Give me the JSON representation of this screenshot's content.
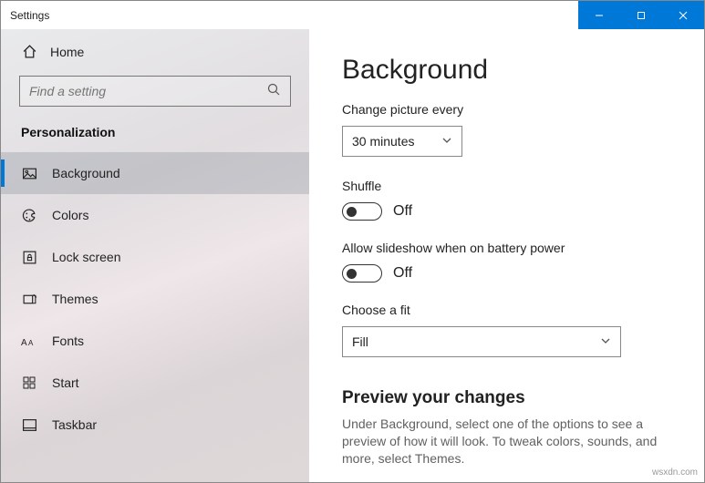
{
  "window": {
    "title": "Settings"
  },
  "sidebar": {
    "home": "Home",
    "search_placeholder": "Find a setting",
    "section": "Personalization",
    "items": [
      {
        "label": "Background"
      },
      {
        "label": "Colors"
      },
      {
        "label": "Lock screen"
      },
      {
        "label": "Themes"
      },
      {
        "label": "Fonts"
      },
      {
        "label": "Start"
      },
      {
        "label": "Taskbar"
      }
    ]
  },
  "content": {
    "title": "Background",
    "change_label": "Change picture every",
    "change_value": "30 minutes",
    "shuffle_label": "Shuffle",
    "shuffle_state": "Off",
    "battery_label": "Allow slideshow when on battery power",
    "battery_state": "Off",
    "fit_label": "Choose a fit",
    "fit_value": "Fill",
    "preview_title": "Preview your changes",
    "preview_desc": "Under Background, select one of the options to see a preview of how it will look. To tweak colors, sounds, and more, select Themes."
  },
  "watermark": "wsxdn.com"
}
